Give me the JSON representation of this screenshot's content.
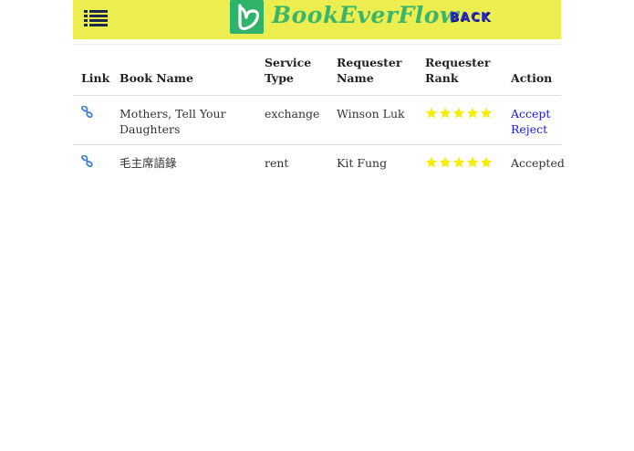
{
  "header": {
    "brand": "BookEverFlow",
    "back_label": "BACK",
    "menu_icon": "list-icon",
    "logo_icon": "heart-b-logo",
    "bar_color": "#ecee4f"
  },
  "table": {
    "headers": {
      "link": "Link",
      "book": "Book Name",
      "service_1": "Service",
      "service_2": "Type",
      "reqname_1": "Requester",
      "reqname_2": "Name",
      "rank_1": "Requester",
      "rank_2": "Rank",
      "action": "Action"
    },
    "rows": [
      {
        "book_line1": "Mothers, Tell Your",
        "book_line2": "Daughters",
        "service_type": "exchange",
        "requester": "Winson Luk",
        "rank_stars": 5,
        "accept": "Accept",
        "reject": "Reject"
      },
      {
        "book_line1": "毛主席語錄",
        "service_type": "rent",
        "requester": "Kit Fung",
        "rank_stars": 5,
        "status": "Accepted"
      }
    ]
  },
  "colors": {
    "star": "#f5ee00",
    "link": "#1a1aee",
    "link_icon": "#3a7fd5"
  }
}
